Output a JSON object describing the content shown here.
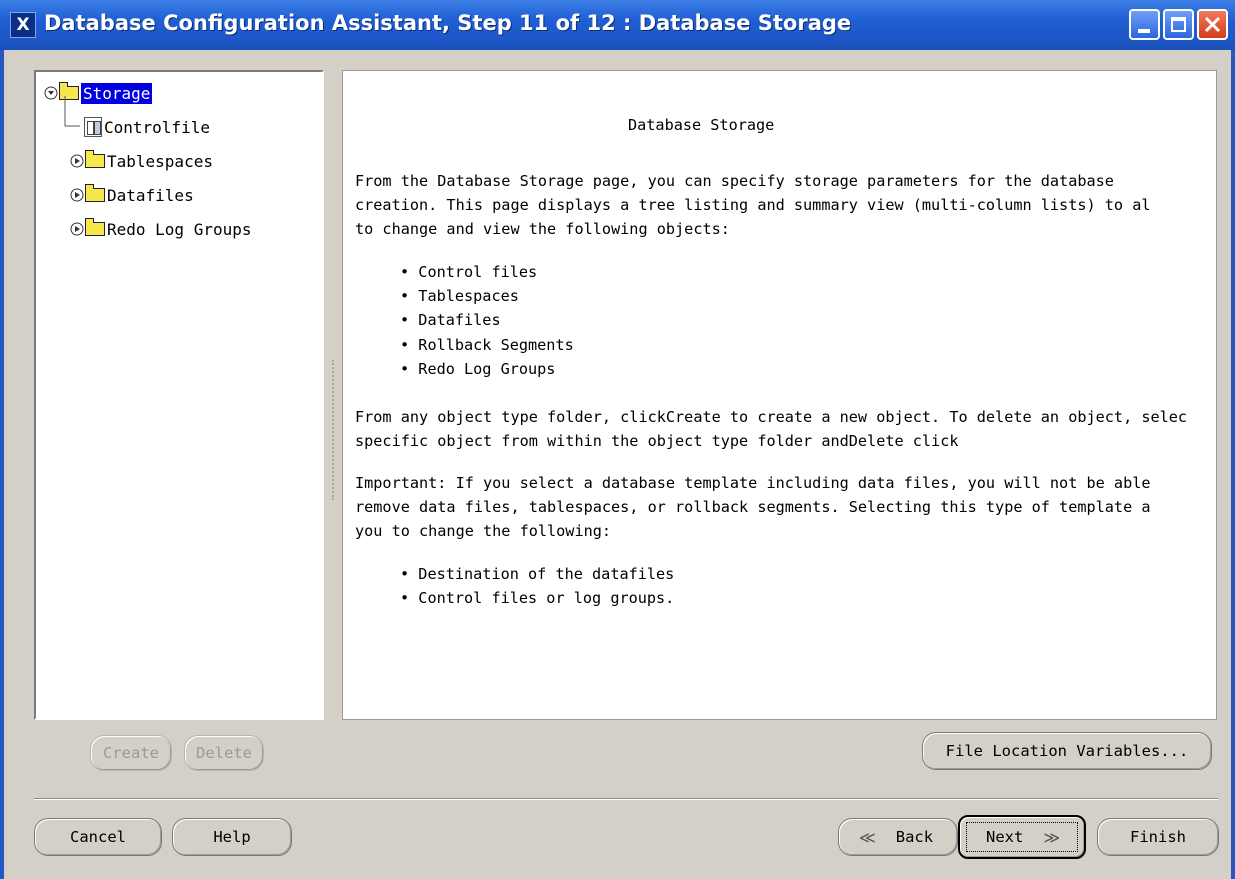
{
  "window": {
    "title": "Database Configuration Assistant, Step 11 of 12 : Database Storage",
    "app_icon": "X"
  },
  "tree": {
    "items": [
      {
        "label": "Storage",
        "icon": "folder-icon",
        "expanded": true,
        "selected": true
      },
      {
        "label": "Controlfile",
        "icon": "controlfile-icon"
      },
      {
        "label": "Tablespaces",
        "icon": "folder-icon",
        "expanded": false
      },
      {
        "label": "Datafiles",
        "icon": "folder-icon",
        "expanded": false
      },
      {
        "label": "Redo Log Groups",
        "icon": "folder-icon",
        "expanded": false
      }
    ]
  },
  "content": {
    "title": "Database Storage",
    "intro": [
      "From the Database Storage  page, you can specify storage parameters for the database",
      "creation. This page displays a tree listing and summary view (multi-column lists) to al",
      "to change and view the following objects:"
    ],
    "objects": [
      "Control files",
      "Tablespaces",
      "Datafiles",
      "Rollback Segments",
      "Redo Log Groups"
    ],
    "instructions": [
      "From any object type folder, clickCreate to create a new object. To delete an object, selec",
      "specific object from within the object type folder andDelete click"
    ],
    "important": [
      "Important: If you select a database template including data files, you will not be able",
      "remove data files, tablespaces, or rollback segments. Selecting this type of template a",
      "you to change the following:"
    ],
    "changeable": [
      "Destination of the datafiles",
      "Control files or log groups."
    ]
  },
  "buttons": {
    "create": "Create",
    "delete": "Delete",
    "file_location_variables": "File Location Variables...",
    "cancel": "Cancel",
    "help": "Help",
    "back": "Back",
    "next": "Next",
    "finish": "Finish"
  },
  "colors": {
    "titlebar": "#1f5fd3",
    "selection": "#0000e0",
    "folder": "#f6e84b"
  }
}
